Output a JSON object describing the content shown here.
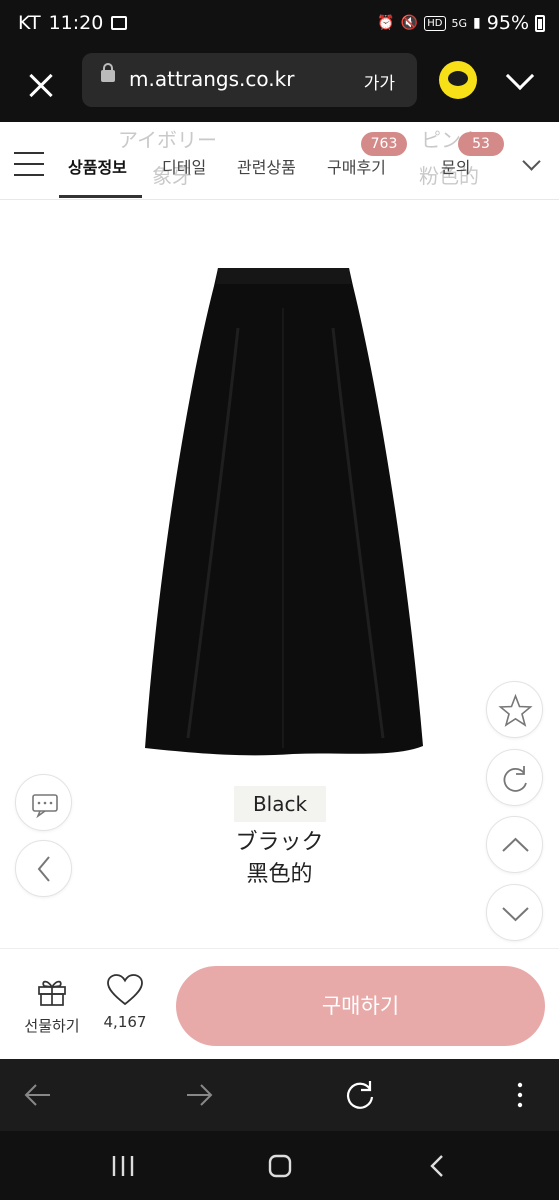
{
  "status_bar": {
    "carrier": "KT",
    "time": "11:20",
    "network": "5G",
    "hd": "HD",
    "battery": "95%"
  },
  "browser": {
    "url": "m.attrangs.co.kr",
    "text_size_label": "가가"
  },
  "tabs": {
    "items": [
      {
        "label": "상품정보"
      },
      {
        "label": "디테일"
      },
      {
        "label": "관련상품"
      },
      {
        "label": "구매후기"
      },
      {
        "label": "문의"
      }
    ],
    "review_badge": "763",
    "qna_badge": "53",
    "ghost_text": [
      "アイボリー",
      "象牙",
      "ピンク",
      "粉色的"
    ]
  },
  "product": {
    "color_en": "Black",
    "color_jp": "ブラック",
    "color_cn": "黑色的"
  },
  "purchase": {
    "gift_label": "선물하기",
    "like_count": "4,167",
    "buy_label": "구매하기"
  },
  "colors": {
    "badge": "#d58a8a",
    "buy_button": "#e8a9a9",
    "kakao": "#f7e018"
  }
}
